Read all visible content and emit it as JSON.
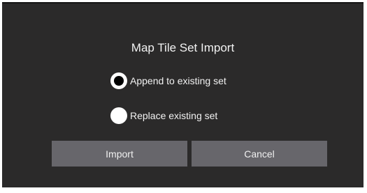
{
  "dialog": {
    "title": "Map Tile Set Import",
    "options": [
      {
        "label": "Append to existing set",
        "selected": true
      },
      {
        "label": "Replace existing set",
        "selected": false
      }
    ],
    "buttons": {
      "import_label": "Import",
      "cancel_label": "Cancel"
    }
  },
  "colors": {
    "background": "#2b2a2a",
    "button": "#67666b",
    "text": "#f2f2f2",
    "radio": "#ffffff"
  }
}
